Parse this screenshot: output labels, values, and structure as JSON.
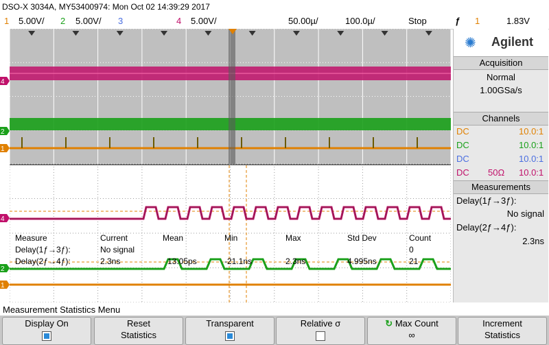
{
  "header": {
    "model_line": "DSO-X 3034A, MY53400974: Mon Oct 02 14:39:29 2017"
  },
  "channels_bar": {
    "ch1_num": "1",
    "ch1_scale": "5.00V/",
    "ch2_num": "2",
    "ch2_scale": "5.00V/",
    "ch3_num": "3",
    "ch4_num": "4",
    "ch4_scale": "5.00V/",
    "timebase": "50.00µ/",
    "delay": "100.0µ/",
    "run_state": "Stop",
    "trigger_icon": "ƒ",
    "trigger_source": "1",
    "trigger_level": "1.83V"
  },
  "colors": {
    "ch1": "#e08000",
    "ch2": "#1aa01a",
    "ch3": "#4a6ee0",
    "ch4": "#c0106a",
    "grid_bg_top": "#bfbfbf",
    "grid_bg_bottom": "#ffffff"
  },
  "right_panel": {
    "brand": "Agilent",
    "acquisition_title": "Acquisition",
    "acq_mode": "Normal",
    "acq_rate": "1.00GSa/s",
    "channels_title": "Channels",
    "channels": [
      {
        "coupling": "DC",
        "imp": "",
        "probe": "10.0:1"
      },
      {
        "coupling": "DC",
        "imp": "",
        "probe": "10.0:1"
      },
      {
        "coupling": "DC",
        "imp": "",
        "probe": "10.0:1"
      },
      {
        "coupling": "DC",
        "imp": "50Ω",
        "probe": "10.0:1"
      }
    ],
    "measurements_title": "Measurements",
    "meas1_label": "Delay(1ƒ→3ƒ):",
    "meas1_value": "No signal",
    "meas2_label": "Delay(2ƒ→4ƒ):",
    "meas2_value": "2.3ns"
  },
  "stats_table": {
    "headers": [
      "Measure",
      "Current",
      "Mean",
      "Min",
      "Max",
      "Std Dev",
      "Count"
    ],
    "rows": [
      [
        "Delay(1ƒ→3ƒ):",
        "No signal",
        "",
        "",
        "",
        "",
        "0"
      ],
      [
        "Delay(2ƒ→4ƒ):",
        "2.3ns",
        "13.05ps",
        "-21.1ns",
        "2.3ns",
        "4.995ns",
        "21"
      ]
    ]
  },
  "menu": {
    "title": "Measurement Statistics Menu",
    "keys": [
      {
        "line1": "Display On",
        "line2": "",
        "checkbox": true
      },
      {
        "line1": "Reset",
        "line2": "Statistics",
        "checkbox": null
      },
      {
        "line1": "Transparent",
        "line2": "",
        "checkbox": true
      },
      {
        "line1": "Relative σ",
        "line2": "",
        "checkbox": false
      },
      {
        "line1": "Max Count",
        "line2": "∞",
        "checkbox": null
      },
      {
        "line1": "Increment",
        "line2": "Statistics",
        "checkbox": null
      }
    ]
  }
}
